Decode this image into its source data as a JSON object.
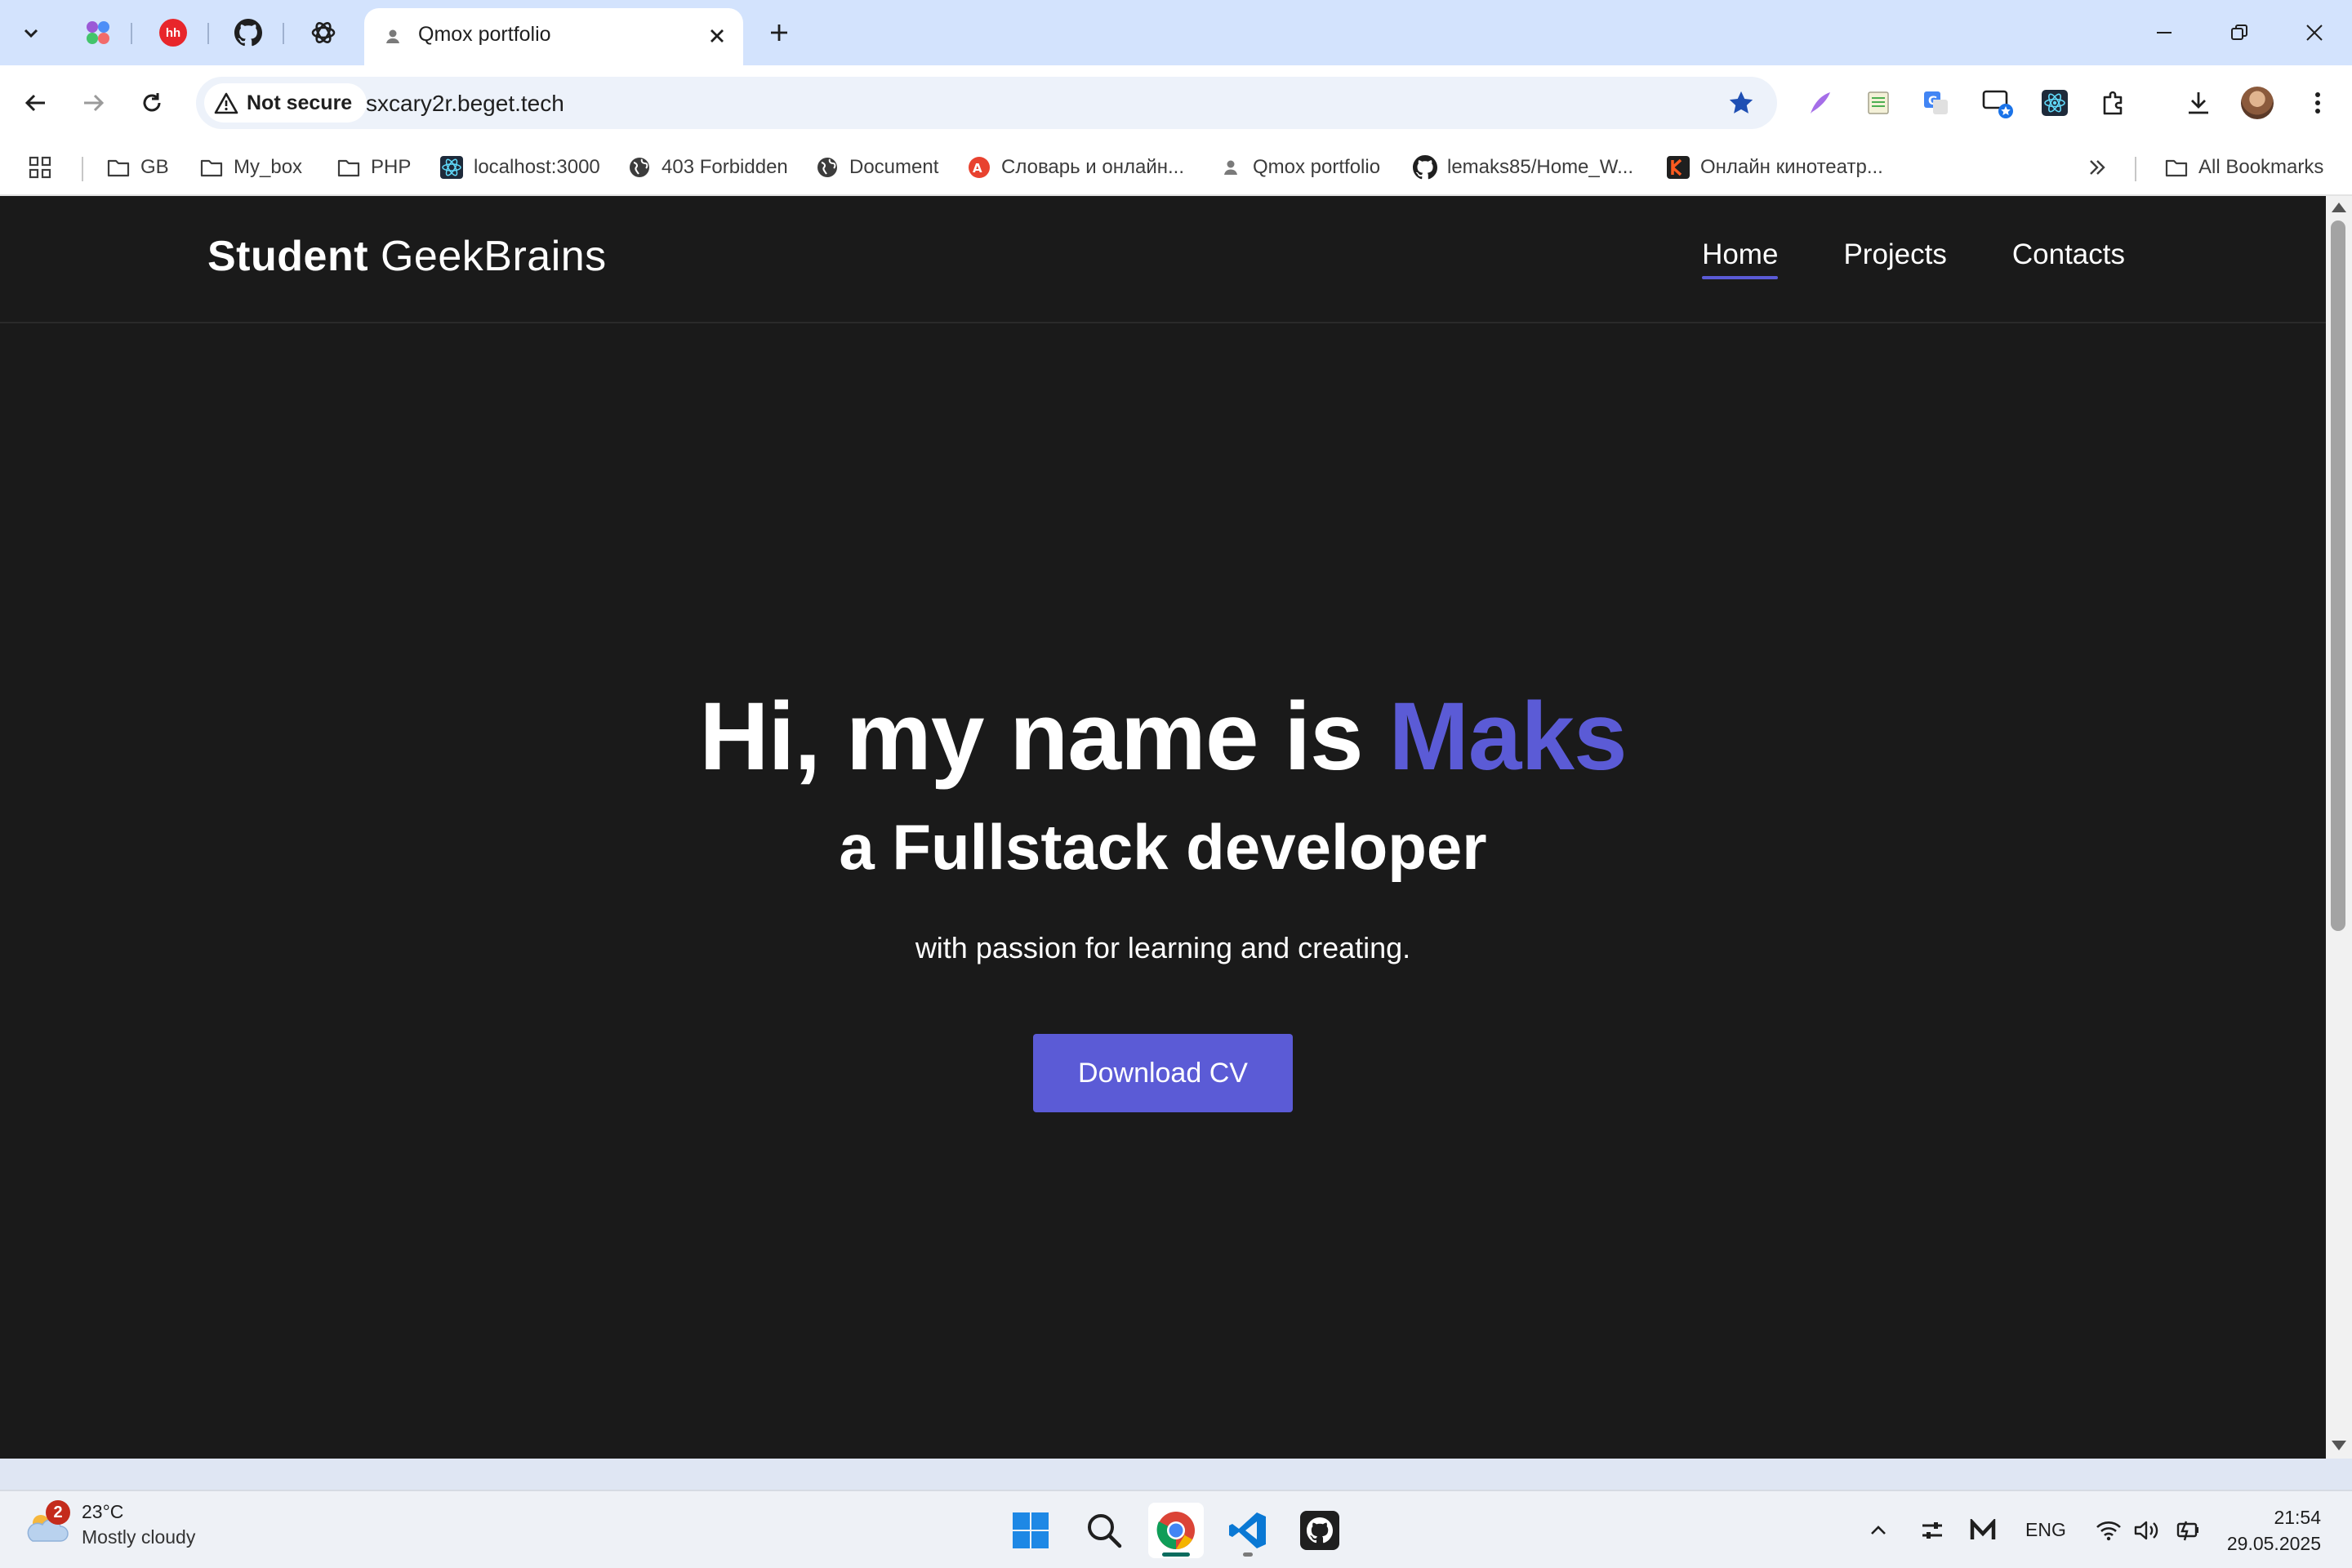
{
  "browser": {
    "active_tab": {
      "title": "Qmox portfolio"
    },
    "pinned_tabs": [
      {
        "icon": "app-launcher-icon"
      },
      {
        "icon": "hh-icon",
        "label": "hh"
      },
      {
        "icon": "github-icon"
      },
      {
        "icon": "openai-icon"
      }
    ],
    "security_label": "Not secure",
    "url": "sxcary2r.beget.tech",
    "accent_color": "#1a73e8"
  },
  "bookmarks": {
    "items": [
      {
        "label": "GB",
        "icon": "folder-icon"
      },
      {
        "label": "My_box",
        "icon": "folder-icon"
      },
      {
        "label": "PHP",
        "icon": "folder-icon"
      },
      {
        "label": "localhost:3000",
        "icon": "react-icon"
      },
      {
        "label": "403 Forbidden",
        "icon": "globe-icon"
      },
      {
        "label": "Document",
        "icon": "globe-icon"
      },
      {
        "label": "Словарь и онлайн...",
        "icon": "dictionary-icon"
      },
      {
        "label": "Qmox portfolio",
        "icon": "user-icon"
      },
      {
        "label": "lemaks85/Home_W...",
        "icon": "github-icon"
      },
      {
        "label": "Онлайн кинотеатр...",
        "icon": "kinopoisk-icon"
      }
    ],
    "all_bookmarks": "All Bookmarks"
  },
  "site": {
    "logo_bold": "Student",
    "logo_regular": "GeekBrains",
    "nav": [
      {
        "label": "Home",
        "active": true
      },
      {
        "label": "Projects",
        "active": false
      },
      {
        "label": "Contacts",
        "active": false
      }
    ],
    "hero": {
      "greeting": "Hi, my name is",
      "name": "Maks",
      "subtitle": "a Fullstack developer",
      "tagline": "with passion for learning and creating.",
      "cta": "Download CV"
    },
    "colors": {
      "background": "#1a1a1a",
      "accent": "#5b5bd6",
      "text": "#ffffff"
    }
  },
  "taskbar": {
    "weather": {
      "badge": "2",
      "temperature": "23°C",
      "condition": "Mostly cloudy"
    },
    "apps": [
      "windows-start-icon",
      "search-icon",
      "chrome-icon",
      "vscode-icon",
      "github-desktop-icon"
    ],
    "language": "ENG",
    "time": "21:54",
    "date": "29.05.2025"
  }
}
